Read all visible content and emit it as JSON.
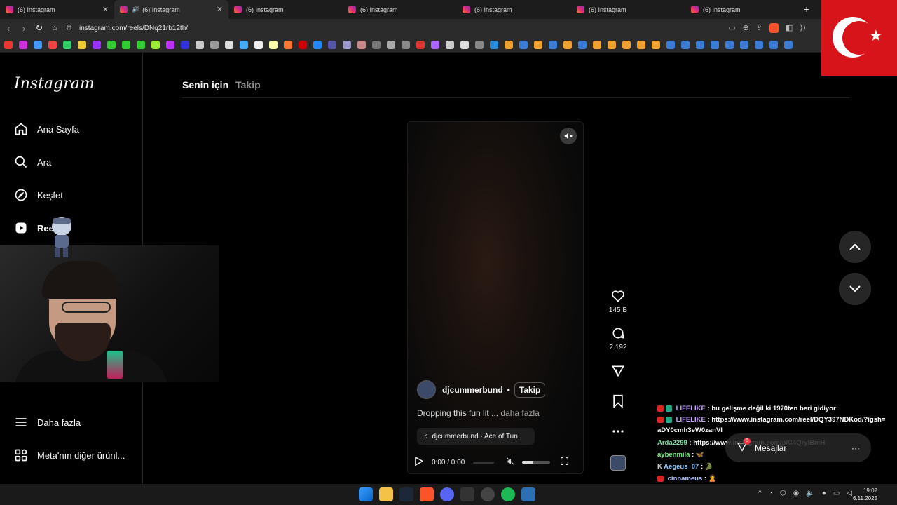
{
  "browser": {
    "tabs": [
      {
        "title": "(6) Instagram",
        "active": false,
        "audio": false
      },
      {
        "title": "(6) Instagram",
        "active": true,
        "audio": true
      },
      {
        "title": "(6) Instagram",
        "active": false,
        "audio": false
      },
      {
        "title": "(6) Instagram",
        "active": false,
        "audio": false
      },
      {
        "title": "(6) Instagram",
        "active": false,
        "audio": false
      },
      {
        "title": "(6) Instagram",
        "active": false,
        "audio": false
      },
      {
        "title": "(6) Instagram",
        "active": false,
        "audio": false
      }
    ],
    "new_tab": "+",
    "url": "instagram.com/reels/DNq21rb12th/"
  },
  "sidebar": {
    "logo": "Instagram",
    "items": [
      {
        "label": "Ana Sayfa",
        "icon": "home-icon"
      },
      {
        "label": "Ara",
        "icon": "search-icon"
      },
      {
        "label": "Keşfet",
        "icon": "compass-icon"
      },
      {
        "label": "Ree",
        "icon": "reels-icon"
      }
    ],
    "bottom": [
      {
        "label": "Daha fazla",
        "icon": "menu-icon"
      },
      {
        "label": "Meta'nın diğer ürünl...",
        "icon": "grid-icon"
      }
    ]
  },
  "feed": {
    "tabs": [
      "Senin için",
      "Takip"
    ]
  },
  "reel": {
    "author": "djcummerbund",
    "separator": "•",
    "follow_label": "Takip",
    "caption": "Dropping this fun lit ...",
    "more_label": "daha fazla",
    "audio": "djcummerbund · Ace of Tun",
    "time": "0:00 / 0:00",
    "volume_level": 0.4
  },
  "actions": {
    "likes": "145 B",
    "comments": "2.192"
  },
  "chat": [
    {
      "user": "LIFELIKE",
      "text": "bu gelişme değil ki 1970ten beri gidiyor",
      "cls": "u-lifelike"
    },
    {
      "user": "LIFELIKE",
      "text": "https://www.instagram.com/reel/DQY397NDKod/?igsh=aDY0cmh3eW0zanVl",
      "cls": "u-lifelike"
    },
    {
      "user": "Arda2299",
      "text": "https://www.instagram.com/p/C4QryiBmH",
      "cls": "u-arda"
    },
    {
      "user": "aybenmila",
      "text": "",
      "cls": "u-ayben"
    },
    {
      "user": "Aegeus_07",
      "text": "",
      "cls": "u-aegeus"
    },
    {
      "user": "cinnameus",
      "text": "",
      "cls": "u-cinn"
    }
  ],
  "messages": {
    "label": "Mesajlar",
    "badge": "6"
  },
  "taskbar": {
    "time": "19:02",
    "date": "6.11.2025"
  },
  "colors": {
    "accent_instagram": "#dd2a7b",
    "flag_red": "#d7141a"
  }
}
